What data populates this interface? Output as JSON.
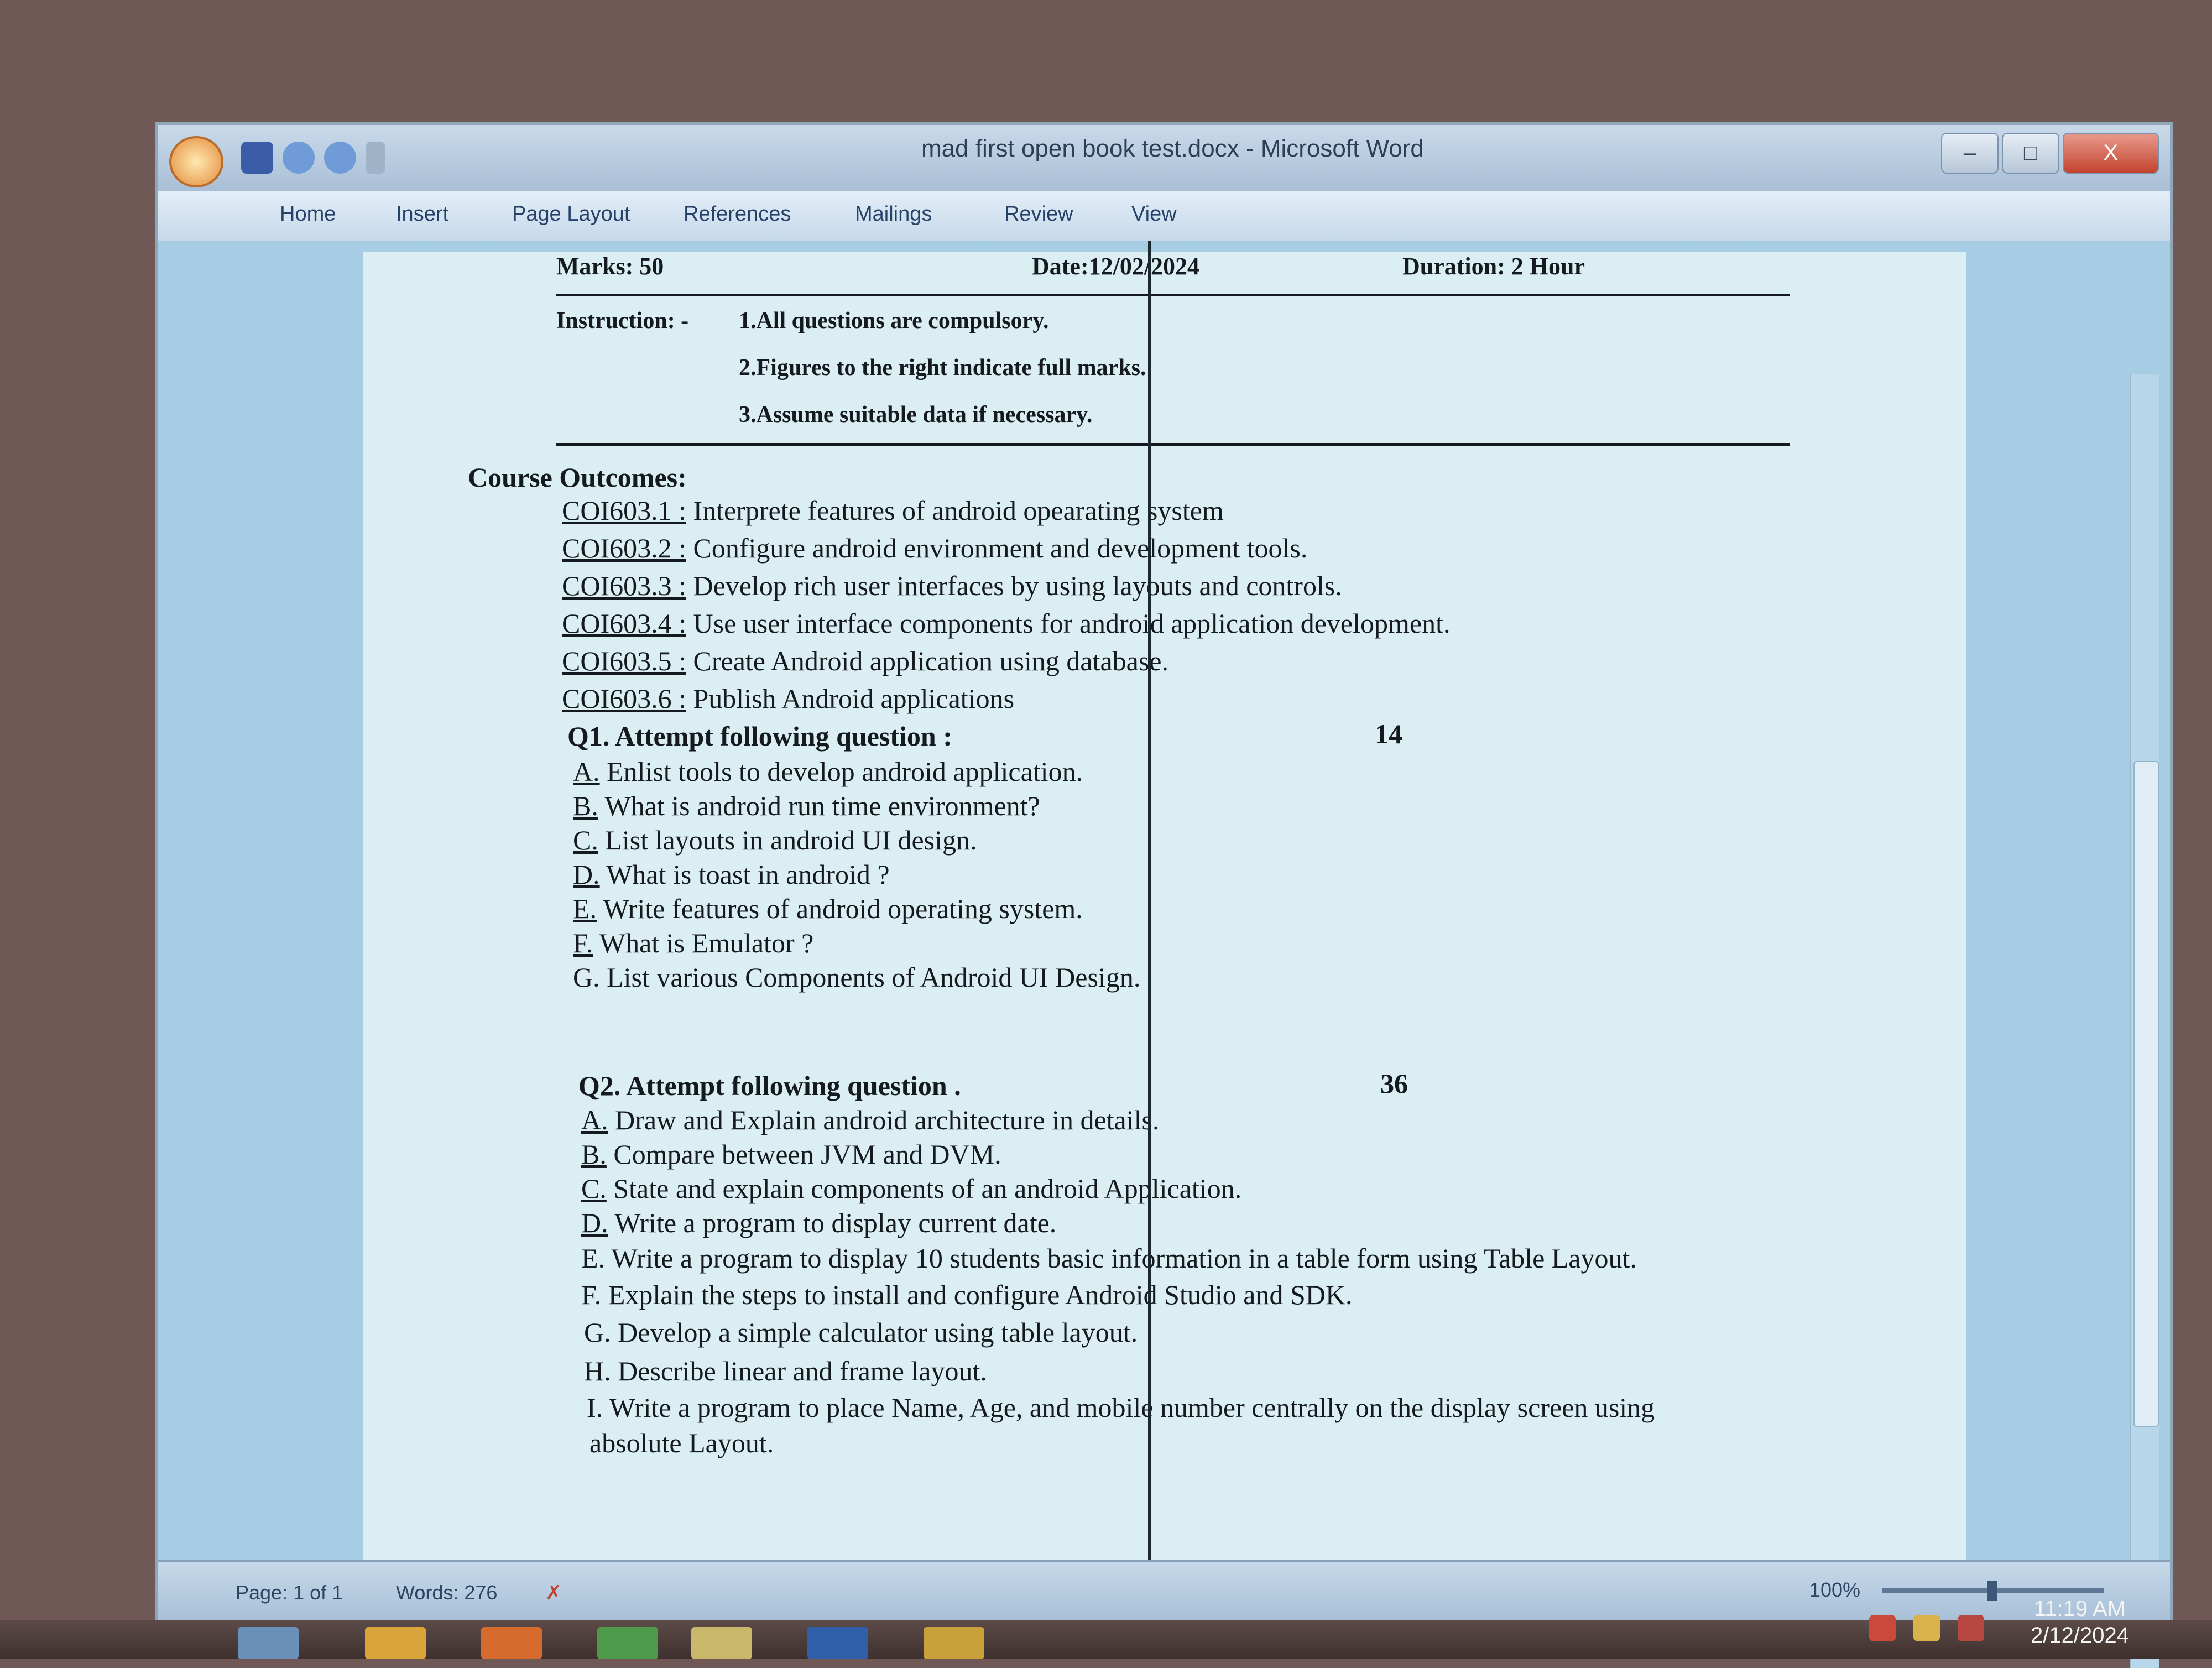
{
  "window": {
    "title": "mad  first open book test.docx - Microsoft Word",
    "buttons": {
      "minimize": "–",
      "restore": "□",
      "close": "X"
    }
  },
  "ribbon": {
    "tabs": [
      "Home",
      "Insert",
      "Page Layout",
      "References",
      "Mailings",
      "Review",
      "View"
    ]
  },
  "document": {
    "header": {
      "marks": "Marks: 50",
      "date": "Date:12/02/2024",
      "duration": "Duration: 2 Hour"
    },
    "instruction_label": "Instruction: -",
    "instructions": [
      "1.All questions are compulsory.",
      "2.Figures to the right indicate full marks.",
      "3.Assume suitable data if necessary."
    ],
    "course_outcomes_title": "Course Outcomes:",
    "course_outcomes": [
      {
        "code": "COI603.1 :",
        "text": " Interprete features of android opearating  system"
      },
      {
        "code": "COI603.2 :",
        "text": " Configure android environment and development tools."
      },
      {
        "code": "COI603.3 :",
        "text": " Develop rich user interfaces by using layouts and controls."
      },
      {
        "code": "COI603.4 :",
        "text": " Use user interface components for android application  development."
      },
      {
        "code": "COI603.5 :",
        "text": " Create Android application using  database."
      },
      {
        "code": "COI603.6 :",
        "text": " Publish Android applications"
      }
    ],
    "q1": {
      "title": "Q1. Attempt following question :",
      "marks": "14",
      "items": [
        {
          "letter": "A.",
          "text": " Enlist tools to develop android application."
        },
        {
          "letter": "B.",
          "text": " What is android run time environment?"
        },
        {
          "letter": "C.",
          "text": " List layouts in android UI  design."
        },
        {
          "letter": "D.",
          "text": " What is toast in android ?"
        },
        {
          "letter": "E.",
          "text": " Write features of android operating system."
        },
        {
          "letter": "F.",
          "text": " What  is Emulator ?"
        },
        {
          "letter": "G.",
          "text": " List various Components of Android UI Design."
        }
      ]
    },
    "q2": {
      "title": "Q2. Attempt following question .",
      "marks": "36",
      "items": [
        {
          "letter": "A.",
          "text": " Draw and Explain android architecture in details."
        },
        {
          "letter": "B.",
          "text": " Compare between JVM and DVM."
        },
        {
          "letter": "C.",
          "text": " State and explain components of an android Application."
        },
        {
          "letter": "D.",
          "text": " Write a program to display current date."
        },
        {
          "letter": "E.",
          "text": " Write a program  to display 10 students basic information in a table form using Table Layout."
        },
        {
          "letter": "F.",
          "text": " Explain the steps to install and configure Android Studio and SDK."
        },
        {
          "letter": "G.",
          "text": " Develop a simple  calculator using table layout."
        },
        {
          "letter": "H.",
          "text": " Describe linear  and frame layout."
        },
        {
          "letter": "I.",
          "text": " Write a program  to place Name, Age, and mobile  number centrally on the display screen using"
        }
      ],
      "continuation": "absolute Layout."
    }
  },
  "status": {
    "page": "Page: 1 of 1",
    "words": "Words: 276",
    "zoom": "100%"
  },
  "tray": {
    "time": "11:19 AM",
    "date": "2/12/2024"
  }
}
